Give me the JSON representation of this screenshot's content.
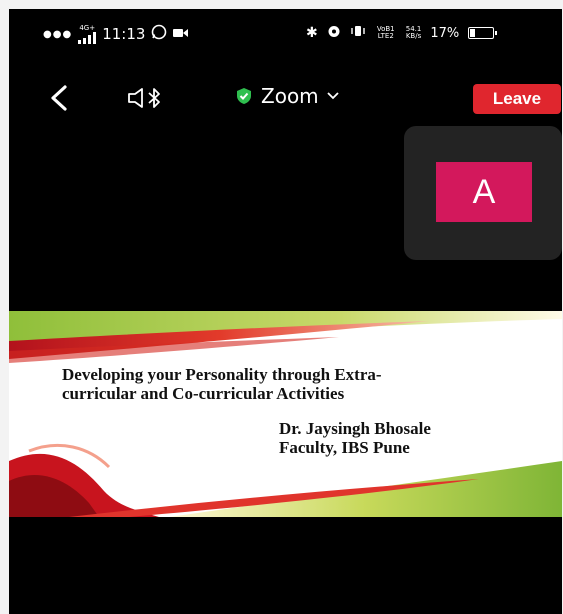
{
  "status_bar": {
    "network_type": "4G+",
    "time": "11:13",
    "volte": "VoB1 LTE2",
    "data_speed_value": "54.1",
    "data_speed_unit": "KB/s",
    "battery_percent": "17%"
  },
  "top_bar": {
    "meeting_name": "Zoom",
    "leave_label": "Leave"
  },
  "participant": {
    "avatar_letter": "A",
    "avatar_color": "#d3185c"
  },
  "shared_slide": {
    "title_line1": "Developing your Personality through Extra-",
    "title_line2": "curricular and Co-curricular Activities",
    "author_name": "Dr. Jaysingh Bhosale",
    "author_affiliation": "Faculty, IBS Pune"
  },
  "colors": {
    "leave_button": "#e0262e",
    "shield_icon": "#2fbf4f"
  }
}
